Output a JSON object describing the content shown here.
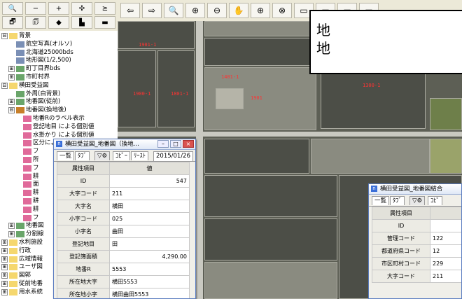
{
  "left_toolbar": {
    "row1": [
      "🔍",
      "−",
      "+",
      "✣",
      "≥"
    ],
    "row2": [
      "🗗",
      "🗊",
      "◆",
      "▙",
      "▬"
    ]
  },
  "tree": {
    "nodes": [
      {
        "exp": "⊟",
        "icon": "folder",
        "label": "背景",
        "indent": 0
      },
      {
        "exp": "",
        "icon": "raster",
        "label": "航空写真(オルソ)",
        "indent": 1
      },
      {
        "exp": "",
        "icon": "raster",
        "label": "北海道25000bds",
        "indent": 1
      },
      {
        "exp": "",
        "icon": "raster",
        "label": "地形図(1/2,500)",
        "indent": 1
      },
      {
        "exp": "⊞",
        "icon": "vector",
        "label": "町丁目界bds",
        "indent": 1
      },
      {
        "exp": "⊞",
        "icon": "vector",
        "label": "市町村界",
        "indent": 1
      },
      {
        "exp": "⊟",
        "icon": "folder",
        "label": "横田受益図",
        "indent": 0
      },
      {
        "exp": "",
        "icon": "vector",
        "label": "外周(白背景)",
        "indent": 1
      },
      {
        "exp": "⊞",
        "icon": "vector",
        "label": "地番図(従前)",
        "indent": 1
      },
      {
        "exp": "⊟",
        "icon": "pen",
        "label": "地番図(換地後)",
        "indent": 1
      },
      {
        "exp": "",
        "icon": "swatch",
        "label": "地番Rのラベル表示",
        "indent": 2
      },
      {
        "exp": "",
        "icon": "swatch",
        "label": "登記地目 による個別値",
        "indent": 2
      },
      {
        "exp": "",
        "icon": "swatch",
        "label": "水掛かり による個別値",
        "indent": 2
      },
      {
        "exp": "",
        "icon": "swatch",
        "label": "区分による個別値",
        "indent": 2
      },
      {
        "exp": "",
        "icon": "swatch",
        "label": "フ",
        "indent": 2
      },
      {
        "exp": "",
        "icon": "swatch",
        "label": "所",
        "indent": 2
      },
      {
        "exp": "",
        "icon": "swatch",
        "label": "フ",
        "indent": 2
      },
      {
        "exp": "",
        "icon": "swatch",
        "label": "耕",
        "indent": 2
      },
      {
        "exp": "",
        "icon": "swatch",
        "label": "面",
        "indent": 2
      },
      {
        "exp": "",
        "icon": "swatch",
        "label": "耕",
        "indent": 2
      },
      {
        "exp": "",
        "icon": "swatch",
        "label": "耕",
        "indent": 2
      },
      {
        "exp": "",
        "icon": "swatch",
        "label": "耕",
        "indent": 2
      },
      {
        "exp": "",
        "icon": "swatch",
        "label": "フ",
        "indent": 2
      },
      {
        "exp": "⊞",
        "icon": "vector",
        "label": "地番図",
        "indent": 1
      },
      {
        "exp": "⊞",
        "icon": "vector",
        "label": "分割線",
        "indent": 1
      },
      {
        "exp": "⊞",
        "icon": "folder",
        "label": "水利施設",
        "indent": 0
      },
      {
        "exp": "⊞",
        "icon": "folder",
        "label": "行政",
        "indent": 0
      },
      {
        "exp": "⊞",
        "icon": "folder",
        "label": "広域情報",
        "indent": 0
      },
      {
        "exp": "⊞",
        "icon": "folder",
        "label": "ユーザ図",
        "indent": 0
      },
      {
        "exp": "⊞",
        "icon": "folder",
        "label": "図郭",
        "indent": 0
      },
      {
        "exp": "⊞",
        "icon": "folder",
        "label": "従前地番",
        "indent": 0
      },
      {
        "exp": "⊞",
        "icon": "folder",
        "label": "用水系統",
        "indent": 0
      }
    ]
  },
  "map_toolbar": {
    "buttons": [
      "⇦",
      "⇨",
      "🔍",
      "⊕",
      "⊖",
      "✋",
      "⊕",
      "⊗",
      "▭",
      "▭",
      "▭",
      "▭"
    ]
  },
  "map": {
    "parcel_labels": [
      "1901-1",
      "1900-1",
      "1801-1",
      "1401-1",
      "1901",
      "1300-1"
    ],
    "callout_lines": [
      "地",
      "地"
    ]
  },
  "win1": {
    "title": "横田受益図_地番図（換地...",
    "tabs": [
      "一覧",
      "ﾀﾌﾞ",
      "ｺﾋﾟｰ",
      "ﾘｰｽﾄ"
    ],
    "date": "2015/01/26",
    "header": {
      "key": "属性項目",
      "value": "値"
    },
    "rows": [
      {
        "key": "ID",
        "value": "547",
        "align": "right"
      },
      {
        "key": "大字コード",
        "value": "211",
        "align": "left"
      },
      {
        "key": "大字名",
        "value": "横田",
        "align": "left"
      },
      {
        "key": "小字コード",
        "value": "025",
        "align": "left"
      },
      {
        "key": "小字名",
        "value": "曲田",
        "align": "left"
      },
      {
        "key": "登記地目",
        "value": "田",
        "align": "left"
      },
      {
        "key": "登記簿面積",
        "value": "4,290.00",
        "align": "right"
      },
      {
        "key": "地番R",
        "value": "5553",
        "align": "left"
      },
      {
        "key": "所在地大字",
        "value": "横田5553",
        "align": "left"
      },
      {
        "key": "所在地小字",
        "value": "横田曲田5553",
        "align": "left"
      }
    ]
  },
  "win2": {
    "title": "横田受益図_地番図結合",
    "tabs": [
      "一覧",
      "ﾀﾌﾞ",
      "ｺﾋﾟ"
    ],
    "header": {
      "key": "属性項目"
    },
    "rows": [
      {
        "key": "ID",
        "value": ""
      },
      {
        "key": "管理コード",
        "value": "122"
      },
      {
        "key": "都道府県コード",
        "value": "12"
      },
      {
        "key": "市区町村コード",
        "value": "229"
      },
      {
        "key": "大字コード",
        "value": "211"
      }
    ]
  },
  "win_buttons": {
    "min": "–",
    "max": "□",
    "close": "×"
  }
}
